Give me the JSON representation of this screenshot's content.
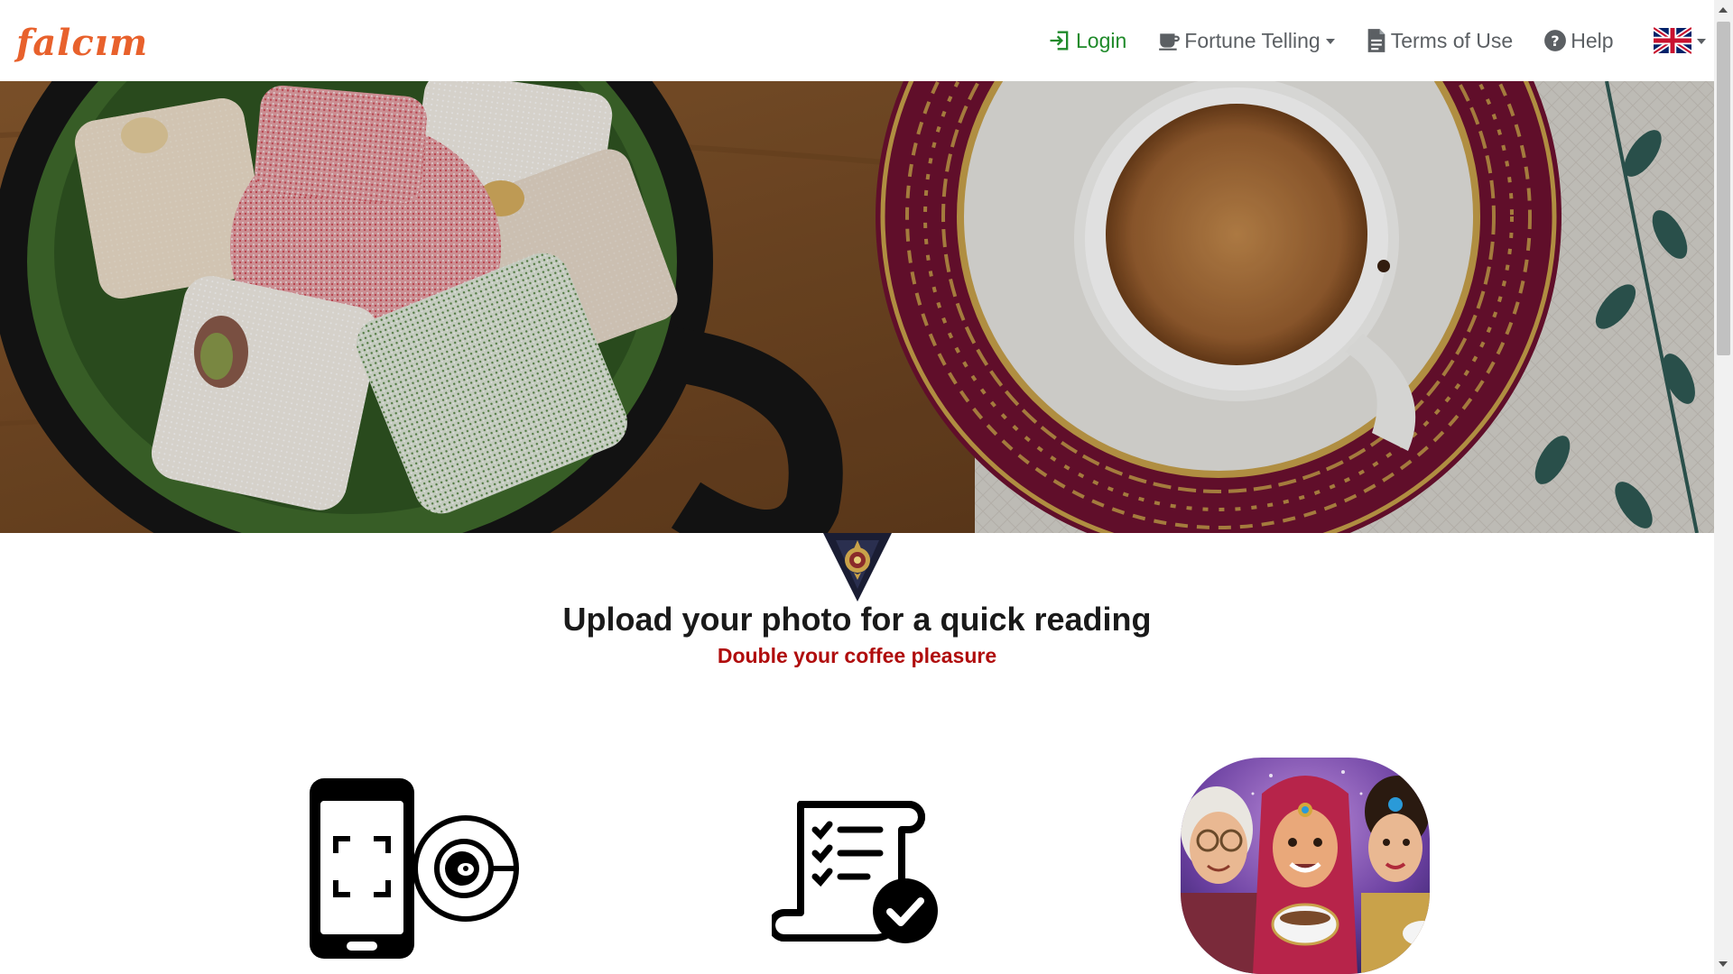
{
  "brand": {
    "name": "falcım",
    "color": "#e8612c"
  },
  "nav": {
    "login": "Login",
    "fortune": "Fortune Telling",
    "terms": "Terms of Use",
    "help": "Help",
    "language_flag": "uk-flag-icon"
  },
  "hero": {
    "image": "turkish-delight-and-coffee-photo"
  },
  "headline": "Upload your photo for a quick reading",
  "subline": "Double your coffee pleasure",
  "steps": [
    {
      "icon": "phone-scan-coffee-cup-icon"
    },
    {
      "icon": "checklist-scroll-icon"
    },
    {
      "icon": "fortune-tellers-illustration"
    }
  ],
  "colors": {
    "login_green": "#1f8a2a",
    "nav_gray": "#5b5f63",
    "subline_red": "#b00d0d",
    "brand_orange": "#e8612c"
  }
}
